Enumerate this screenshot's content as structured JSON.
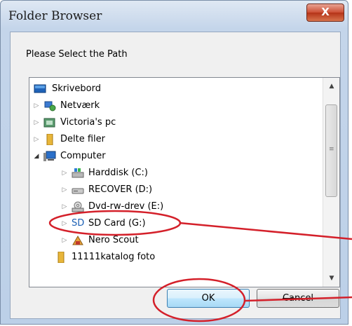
{
  "window": {
    "title": "Folder Browser",
    "close_label": "X"
  },
  "dialog": {
    "prompt": "Please Select the Path"
  },
  "tree": {
    "items": [
      {
        "label": "Skrivebord",
        "icon": "desktop-icon",
        "expander": ""
      },
      {
        "label": "Netværk",
        "icon": "network-icon",
        "expander": "▷"
      },
      {
        "label": "Victoria's pc",
        "icon": "user-folder-icon",
        "expander": "▷"
      },
      {
        "label": "Delte filer",
        "icon": "folder-icon",
        "expander": "▷"
      },
      {
        "label": "Computer",
        "icon": "computer-icon",
        "expander": "◢"
      },
      {
        "label": "Harddisk (C:)",
        "icon": "harddisk-icon",
        "expander": "▷"
      },
      {
        "label": "RECOVER (D:)",
        "icon": "drive-icon",
        "expander": "▷"
      },
      {
        "label": "Dvd-rw-drev (E:)",
        "icon": "dvd-drive-icon",
        "expander": "▷"
      },
      {
        "label": "SD Card (G:)",
        "icon": "sd-card-icon",
        "expander": "▷",
        "icon_text": "SD"
      },
      {
        "label": "Nero Scout",
        "icon": "nero-scout-icon",
        "expander": "▷"
      },
      {
        "label": "11111katalog foto",
        "icon": "folder-icon",
        "expander": ""
      }
    ]
  },
  "buttons": {
    "ok": "OK",
    "cancel": "Cancel"
  },
  "annotation_color": "#d4202a"
}
